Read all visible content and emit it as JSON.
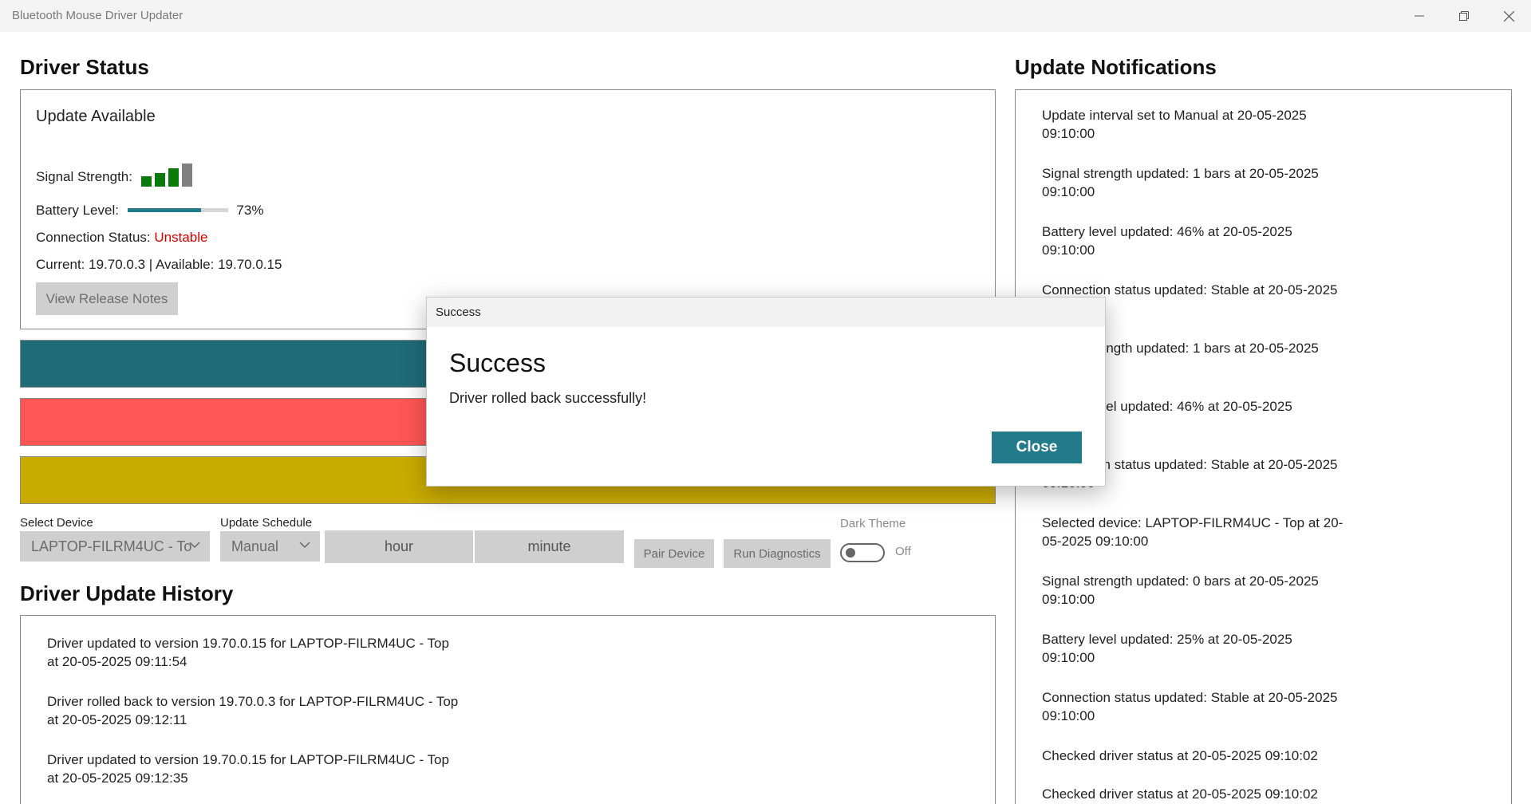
{
  "window": {
    "title": "Bluetooth Mouse Driver Updater"
  },
  "driver_status": {
    "title": "Driver Status",
    "status_text": "Update Available",
    "signal_label": "Signal Strength:",
    "signal_bars_active": 3,
    "signal_bars_total": 4,
    "battery_label": "Battery Level:",
    "battery_percent": 73,
    "battery_text": "73%",
    "connection_label": "Connection Status:",
    "connection_value": "Unstable",
    "version_text": "Current: 19.70.0.3 | Available: 19.70.0.15",
    "release_notes_button": "View Release Notes"
  },
  "colors": {
    "accent": "#237a8a",
    "update_bar": "#1f6b78",
    "rollback_bar": "#ff5555",
    "backup_bar": "#c9ab00",
    "signal_active": "#0a7a0a",
    "signal_inactive": "#808080",
    "unstable": "#d40000"
  },
  "controls": {
    "device_label": "Select Device",
    "device_value": "LAPTOP-FILRM4UC - To",
    "schedule_label": "Update Schedule",
    "schedule_value": "Manual",
    "hour_label": "hour",
    "minute_label": "minute",
    "pair_button": "Pair Device",
    "diagnostics_button": "Run Diagnostics",
    "theme_label": "Dark Theme",
    "theme_state": "Off"
  },
  "history": {
    "title": "Driver Update History",
    "items": [
      "Driver updated to version 19.70.0.15 for LAPTOP-FILRM4UC - Top at 20-05-2025 09:11:54",
      "Driver rolled back to version 19.70.0.3 for LAPTOP-FILRM4UC - Top at 20-05-2025 09:12:11",
      "Driver updated to version 19.70.0.15 for LAPTOP-FILRM4UC - Top at 20-05-2025 09:12:35"
    ]
  },
  "notifications": {
    "title": "Update Notifications",
    "items": [
      "Update interval set to Manual at 20-05-2025 09:10:00",
      "Signal strength updated: 1 bars at 20-05-2025 09:10:00",
      "Battery level updated: 46% at 20-05-2025 09:10:00",
      "Connection status updated: Stable at 20-05-2025 09:10:00",
      "Signal strength updated: 1 bars at 20-05-2025 09:10:00",
      "Battery level updated: 46% at 20-05-2025 09:10:00",
      "Connection status updated: Stable at 20-05-2025 09:10:00",
      "Selected device: LAPTOP-FILRM4UC - Top at 20-05-2025 09:10:00",
      "Signal strength updated: 0 bars at 20-05-2025 09:10:00",
      "Battery level updated: 25% at 20-05-2025 09:10:00",
      "Connection status updated: Stable at 20-05-2025 09:10:00",
      "Checked driver status at 20-05-2025 09:10:02",
      "Checked driver status at 20-05-2025 09:10:02"
    ]
  },
  "dialog": {
    "window_title": "Success",
    "heading": "Success",
    "message": "Driver rolled back successfully!",
    "close_button": "Close"
  }
}
